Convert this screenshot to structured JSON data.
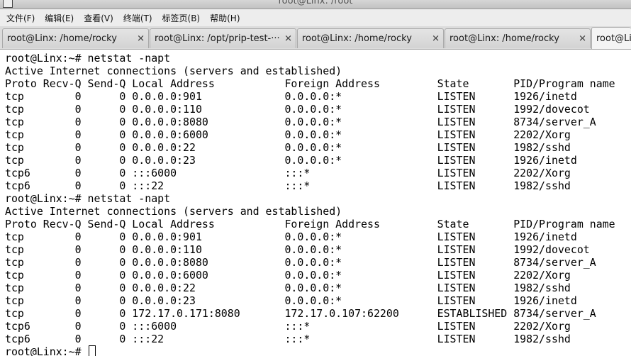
{
  "window": {
    "title": "root@Linx: /root"
  },
  "menu": [
    {
      "label": "文件(F)"
    },
    {
      "label": "编辑(E)"
    },
    {
      "label": "查看(V)"
    },
    {
      "label": "终端(T)"
    },
    {
      "label": "标签页(B)"
    },
    {
      "label": "帮助(H)"
    }
  ],
  "tabs": [
    {
      "label": "root@Linx: /home/rocky",
      "close": "✕"
    },
    {
      "label": "root@Linx: /opt/prip-test-···",
      "close": "✕"
    },
    {
      "label": "root@Linx: /home/rocky",
      "close": "✕"
    },
    {
      "label": "root@Linx: /home/rocky",
      "close": "✕"
    },
    {
      "label": "root@Linx",
      "close": ""
    }
  ],
  "terminal": {
    "lines": [
      "root@Linx:~# netstat -napt",
      "Active Internet connections (servers and established)",
      "Proto Recv-Q Send-Q Local Address           Foreign Address         State       PID/Program name",
      "tcp        0      0 0.0.0.0:901             0.0.0.0:*               LISTEN      1926/inetd",
      "tcp        0      0 0.0.0.0:110             0.0.0.0:*               LISTEN      1992/dovecot",
      "tcp        0      0 0.0.0.0:8080            0.0.0.0:*               LISTEN      8734/server_A",
      "tcp        0      0 0.0.0.0:6000            0.0.0.0:*               LISTEN      2202/Xorg",
      "tcp        0      0 0.0.0.0:22              0.0.0.0:*               LISTEN      1982/sshd",
      "tcp        0      0 0.0.0.0:23              0.0.0.0:*               LISTEN      1926/inetd",
      "tcp6       0      0 :::6000                 :::*                    LISTEN      2202/Xorg",
      "tcp6       0      0 :::22                   :::*                    LISTEN      1982/sshd",
      "root@Linx:~# netstat -napt",
      "Active Internet connections (servers and established)",
      "Proto Recv-Q Send-Q Local Address           Foreign Address         State       PID/Program name",
      "tcp        0      0 0.0.0.0:901             0.0.0.0:*               LISTEN      1926/inetd",
      "tcp        0      0 0.0.0.0:110             0.0.0.0:*               LISTEN      1992/dovecot",
      "tcp        0      0 0.0.0.0:8080            0.0.0.0:*               LISTEN      8734/server_A",
      "tcp        0      0 0.0.0.0:6000            0.0.0.0:*               LISTEN      2202/Xorg",
      "tcp        0      0 0.0.0.0:22              0.0.0.0:*               LISTEN      1982/sshd",
      "tcp        0      0 0.0.0.0:23              0.0.0.0:*               LISTEN      1926/inetd",
      "tcp        0      0 172.17.0.171:8080       172.17.0.107:62200      ESTABLISHED 8734/server_A",
      "tcp6       0      0 :::6000                 :::*                    LISTEN      2202/Xorg",
      "tcp6       0      0 :::22                   :::*                    LISTEN      1982/sshd"
    ],
    "prompt": "root@Linx:~# "
  }
}
